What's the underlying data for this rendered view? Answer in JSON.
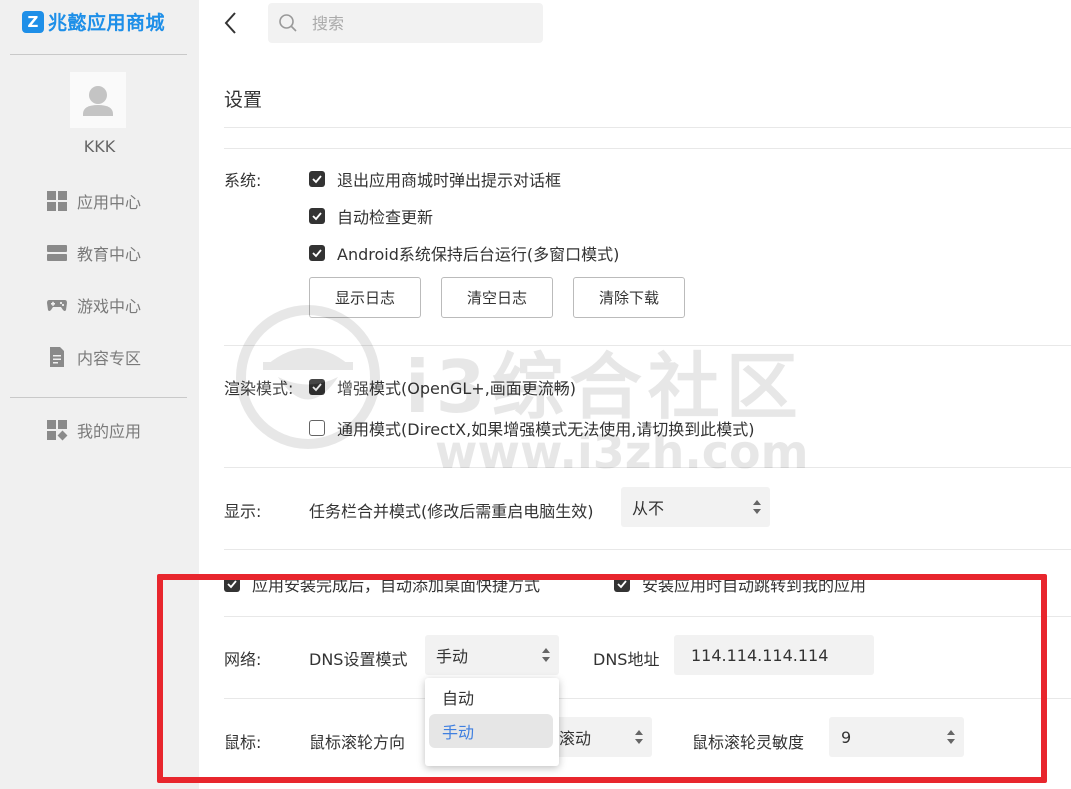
{
  "app": {
    "logo_text": "兆懿应用商城",
    "logo_mark": "Z",
    "brand_color": "#1e8fe8"
  },
  "sidebar": {
    "username": "KKK",
    "items": [
      {
        "label": "应用中心",
        "icon": "grid-icon"
      },
      {
        "label": "教育中心",
        "icon": "book-icon"
      },
      {
        "label": "游戏中心",
        "icon": "gamepad-icon"
      },
      {
        "label": "内容专区",
        "icon": "document-icon"
      },
      {
        "label": "我的应用",
        "icon": "apps-icon"
      }
    ]
  },
  "search": {
    "placeholder": "搜索"
  },
  "page": {
    "title": "设置"
  },
  "system": {
    "label": "系统:",
    "options": [
      {
        "label": "退出应用商城时弹出提示对话框",
        "checked": true
      },
      {
        "label": "自动检查更新",
        "checked": true
      },
      {
        "label": "Android系统保持后台运行(多窗口模式)",
        "checked": true
      }
    ],
    "buttons": [
      "显示日志",
      "清空日志",
      "清除下载"
    ]
  },
  "render": {
    "label": "渲染模式:",
    "options": [
      {
        "label": "增强模式(OpenGL+,画面更流畅)",
        "checked": true
      },
      {
        "label": "通用模式(DirectX,如果增强模式无法使用,请切换到此模式)",
        "checked": false
      }
    ]
  },
  "display": {
    "label": "显示:",
    "taskbar_label": "任务栏合并模式(修改后需重启电脑生效)",
    "taskbar_value": "从不"
  },
  "install": {
    "options": [
      {
        "label": "应用安装完成后，自动添加桌面快捷方式",
        "checked": true
      },
      {
        "label": "安装应用时自动跳转到我的应用",
        "checked": true
      }
    ]
  },
  "network": {
    "label": "网络:",
    "dns_mode_label": "DNS设置模式",
    "dns_mode_value": "手动",
    "dns_address_label": "DNS地址",
    "dns_address_value": "114.114.114.114",
    "dropdown_options": [
      "自动",
      "手动"
    ],
    "dropdown_selected": "手动"
  },
  "mouse": {
    "label": "鼠标:",
    "direction_label": "鼠标滚轮方向",
    "direction_value": "滚动",
    "sensitivity_label": "鼠标滚轮灵敏度",
    "sensitivity_value": "9"
  },
  "watermark": {
    "text": "i3综合社区",
    "url": "www.i3zh.com"
  },
  "colors": {
    "highlight": "#e8262d",
    "selected_option": "#3f7fe0"
  }
}
